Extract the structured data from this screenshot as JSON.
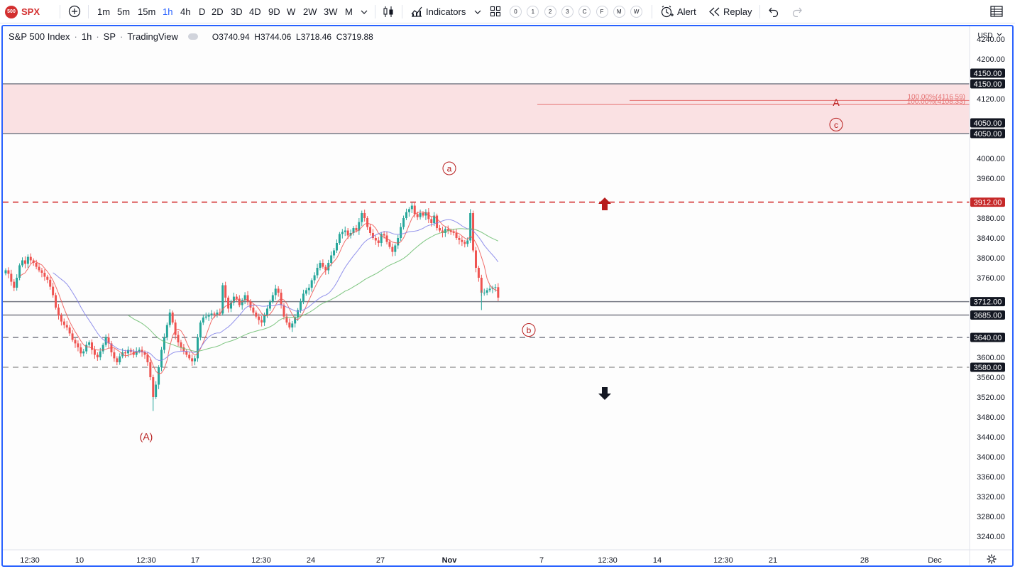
{
  "toolbar": {
    "symbol": "SPX",
    "symbol_logo": "500",
    "intervals": [
      "1m",
      "5m",
      "15m",
      "1h",
      "4h",
      "D",
      "2D",
      "3D",
      "4D",
      "9D",
      "W",
      "2W",
      "3W",
      "M"
    ],
    "active_interval": "1h",
    "indicators_label": "Indicators",
    "layout_slots": [
      "0",
      "1",
      "2",
      "3",
      "C",
      "F",
      "M",
      "W"
    ],
    "alert_label": "Alert",
    "replay_label": "Replay",
    "icons": [
      "add-symbol-icon",
      "chevron-down-icon",
      "candles-icon",
      "indicators-icon",
      "layout-grid-icon",
      "alert-icon",
      "replay-icon",
      "undo-icon",
      "redo-icon",
      "table-icon"
    ]
  },
  "legend": {
    "title": "S&P 500 Index",
    "interval": "1h",
    "exchange": "SP",
    "source": "TradingView",
    "open_label": "O",
    "open": "3740.94",
    "high_label": "H",
    "high": "3744.06",
    "low_label": "L",
    "low": "3718.46",
    "close_label": "C",
    "close": "3719.88"
  },
  "currency": "USD",
  "settings_icon": "gear-icon",
  "colors": {
    "up": "#26a69a",
    "down": "#ef5350",
    "accent": "#2962ff",
    "ma_fast": "#ef5350",
    "ma_mid": "#7e7ee8",
    "ma_slow": "#66bb6a",
    "zone_fill": "#f8d7da",
    "annotation": "#b71c1c"
  },
  "chart_data": {
    "type": "candlestick",
    "price_ticks": [
      4240,
      4200,
      4120,
      4000,
      3960,
      3880,
      3840,
      3800,
      3760,
      3600,
      3560,
      3520,
      3480,
      3440,
      3400,
      3360,
      3320,
      3280,
      3240
    ],
    "time_labels": [
      "12:30",
      "10",
      "12:30",
      "17",
      "12:30",
      "24",
      "27",
      "Nov",
      "7",
      "12:30",
      "14",
      "12:30",
      "21",
      "28",
      "Dec"
    ],
    "levels": [
      {
        "price": 4150,
        "label": "4150.00",
        "style": "solid",
        "color": "#787b86"
      },
      {
        "price": 4050,
        "label": "4050.00",
        "style": "solid",
        "color": "#787b86"
      },
      {
        "price": 3912,
        "label": "3912.00",
        "style": "dashed",
        "color": "#d32f2f"
      },
      {
        "price": 3712,
        "label": "3712.00",
        "style": "solid",
        "color": "#787b86"
      },
      {
        "price": 3685,
        "label": "3685.00",
        "style": "solid",
        "color": "#787b86"
      },
      {
        "price": 3640,
        "label": "3640.00",
        "style": "dashed",
        "color": "#787b86"
      },
      {
        "price": 3580,
        "label": "3580.00",
        "style": "dashed",
        "color": "#9e9e9e"
      }
    ],
    "zone": {
      "from": 4050,
      "to": 4150
    },
    "fib_labels": [
      "100.00%(4116.59)",
      "100.00%(4108.33)"
    ],
    "annotations": [
      {
        "text": "(A)",
        "circled": false
      },
      {
        "text": "a",
        "circled": true
      },
      {
        "text": "b",
        "circled": true
      },
      {
        "text": "c",
        "circled": true
      },
      {
        "text": "A",
        "circled": false
      }
    ],
    "closes": [
      3775,
      3768,
      3752,
      3740,
      3760,
      3785,
      3795,
      3788,
      3802,
      3795,
      3790,
      3782,
      3775,
      3770,
      3762,
      3756,
      3742,
      3725,
      3700,
      3685,
      3672,
      3665,
      3660,
      3648,
      3635,
      3628,
      3620,
      3608,
      3612,
      3625,
      3630,
      3615,
      3605,
      3600,
      3612,
      3625,
      3640,
      3628,
      3610,
      3598,
      3590,
      3602,
      3610,
      3608,
      3615,
      3611,
      3605,
      3612,
      3615,
      3610,
      3605,
      3590,
      3560,
      3520,
      3545,
      3580,
      3615,
      3640,
      3665,
      3690,
      3670,
      3645,
      3630,
      3620,
      3612,
      3605,
      3598,
      3592,
      3598,
      3640,
      3670,
      3680,
      3682,
      3685,
      3688,
      3686,
      3690,
      3688,
      3745,
      3720,
      3698,
      3710,
      3722,
      3718,
      3705,
      3715,
      3725,
      3712,
      3700,
      3690,
      3682,
      3675,
      3670,
      3685,
      3698,
      3712,
      3725,
      3738,
      3730,
      3705,
      3682,
      3670,
      3660,
      3668,
      3680,
      3695,
      3712,
      3728,
      3735,
      3740,
      3755,
      3765,
      3780,
      3790,
      3782,
      3775,
      3790,
      3805,
      3815,
      3830,
      3848,
      3852,
      3855,
      3845,
      3850,
      3860,
      3855,
      3872,
      3890,
      3880,
      3862,
      3850,
      3840,
      3835,
      3830,
      3848,
      3845,
      3832,
      3822,
      3812,
      3825,
      3840,
      3862,
      3880,
      3892,
      3898,
      3905,
      3888,
      3882,
      3890,
      3885,
      3892,
      3878,
      3870,
      3885,
      3860,
      3855,
      3850,
      3858,
      3855,
      3852,
      3850,
      3840,
      3836,
      3832,
      3828,
      3835,
      3890,
      3815,
      3780,
      3760,
      3730,
      3730,
      3735,
      3738,
      3740,
      3741,
      3720
    ]
  }
}
